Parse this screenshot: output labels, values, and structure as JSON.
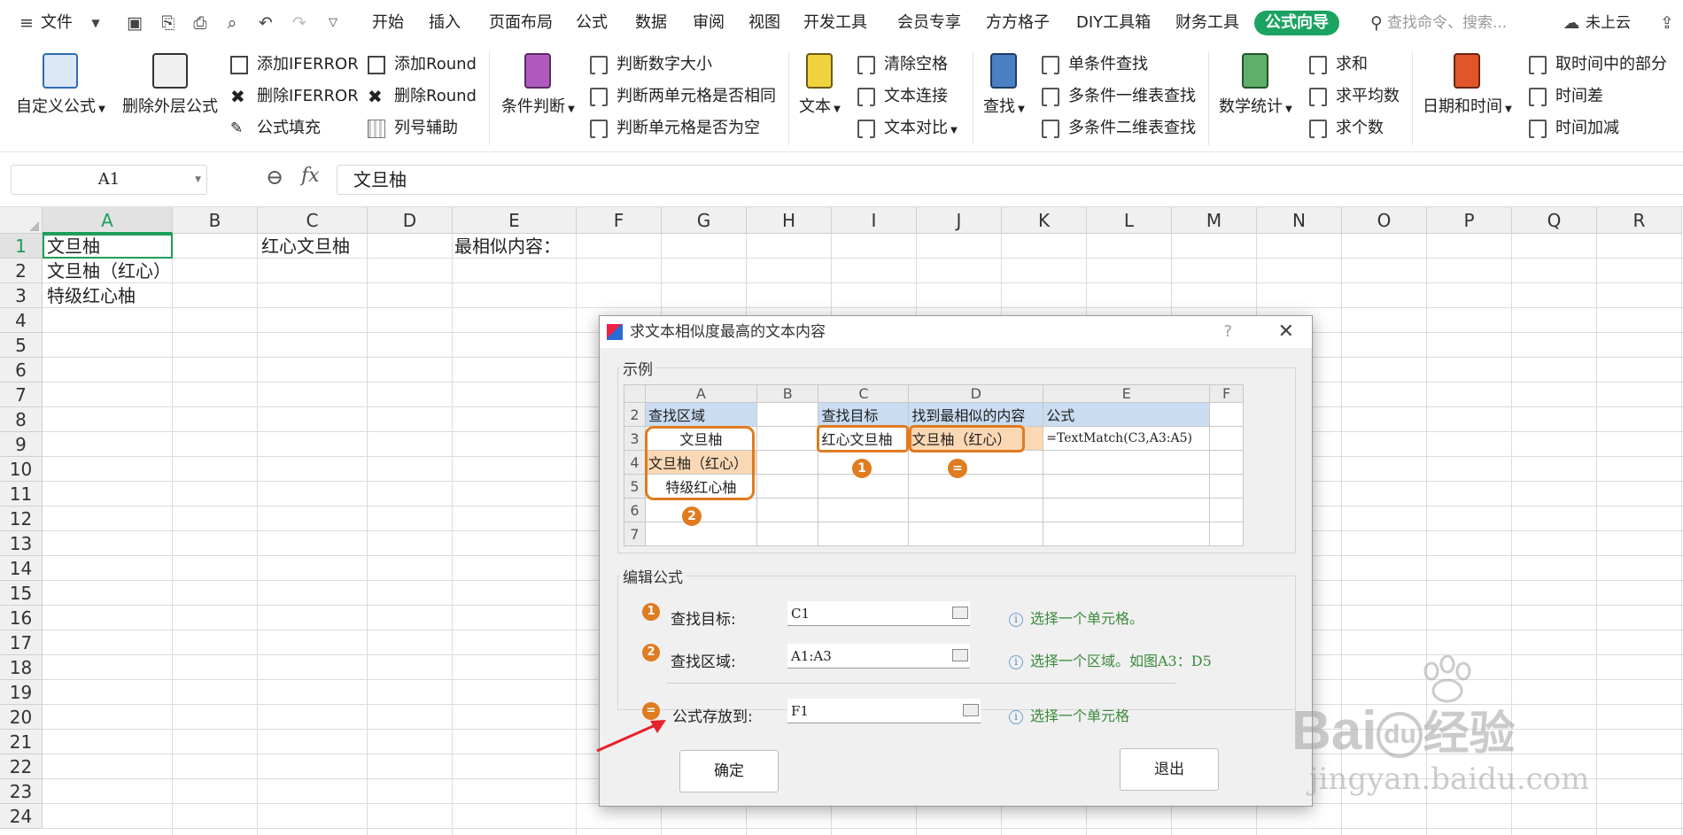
{
  "toolbar": {
    "file_menu": "文件",
    "tabs": [
      "开始",
      "插入",
      "页面布局",
      "公式",
      "数据",
      "审阅",
      "视图",
      "开发工具",
      "会员专享",
      "方方格子",
      "DIY工具箱",
      "财务工具",
      "公式向导"
    ],
    "search_placeholder": "查找命令、搜索...",
    "cloud_label": "未上云"
  },
  "ribbon": {
    "custom_formula": "自定义公式",
    "delete_outer": "删除外层公式",
    "add_iferror": "添加IFERROR",
    "del_iferror": "删除IFERROR",
    "formula_fill": "公式填充",
    "add_round": "添加Round",
    "del_round": "删除Round",
    "column_helper": "列号辅助",
    "condition": "条件判断",
    "judge_size": "判断数字大小",
    "judge_same": "判断两单元格是否相同",
    "judge_empty": "判断单元格是否为空",
    "text": "文本",
    "clear_space": "清除空格",
    "text_join": "文本连接",
    "text_compare": "文本对比",
    "find": "查找",
    "single_find": "单条件查找",
    "multi_1d": "多条件一维表查找",
    "multi_2d": "多条件二维表查找",
    "math_stats": "数学统计",
    "sum": "求和",
    "avg": "求平均数",
    "count": "求个数",
    "datetime": "日期和时间",
    "time_part": "取时间中的部分",
    "time_diff": "时间差",
    "time_add": "时间加减"
  },
  "formula_bar": {
    "name_box": "A1",
    "fx": "fx",
    "value": "文旦柚"
  },
  "sheet": {
    "columns": [
      "A",
      "B",
      "C",
      "D",
      "E",
      "F",
      "G",
      "H",
      "I",
      "J",
      "K",
      "L",
      "M",
      "N",
      "O",
      "P",
      "Q",
      "R"
    ],
    "rows": [
      "1",
      "2",
      "3",
      "4",
      "5",
      "6",
      "7",
      "8",
      "9",
      "10",
      "11",
      "12",
      "13",
      "14",
      "15",
      "16",
      "17",
      "18",
      "19",
      "20",
      "21",
      "22",
      "23",
      "24"
    ],
    "a1": "文旦柚",
    "a2": "文旦柚（红心）",
    "a3": "特级红心柚",
    "c1": "红心文旦柚",
    "e1": "最相似内容："
  },
  "dialog": {
    "title": "求文本相似度最高的文本内容",
    "help": "?",
    "close": "✕",
    "example_label": "示例",
    "example": {
      "cols": [
        "A",
        "B",
        "C",
        "D",
        "E",
        "F"
      ],
      "rows": [
        "2",
        "3",
        "4",
        "5",
        "6",
        "7"
      ],
      "r2a": "查找区域",
      "r2c": "查找目标",
      "r2d": "找到最相似的内容",
      "r2e": "公式",
      "r3a": "文旦柚",
      "r3c": "红心文旦柚",
      "r3d": "文旦柚（红心）",
      "r3e": "=TextMatch(C3,A3:A5)",
      "r4a": "文旦柚（红心）",
      "r5a": "特级红心柚",
      "badge1": "1",
      "badge2": "2",
      "badge3": "="
    },
    "edit_label": "编辑公式",
    "field1_label": "查找目标:",
    "field1_value": "C1",
    "field1_hint": "选择一个单元格。",
    "field2_label": "查找区域:",
    "field2_value": "A1:A3",
    "field2_hint": "选择一个区域。如图A3：D5",
    "field3_label": "公式存放到:",
    "field3_value": "F1",
    "field3_hint": "选择一个单元格",
    "ok": "确定",
    "exit": "退出"
  },
  "watermark": {
    "brand": "Bai",
    "brand2": "du",
    "brand_cn": "经验",
    "url": "jingyan.baidu.com"
  },
  "colors": {
    "accent_green": "#1aa361",
    "highlight_orange": "#e07b20",
    "header_blue": "#c9dcf1"
  }
}
